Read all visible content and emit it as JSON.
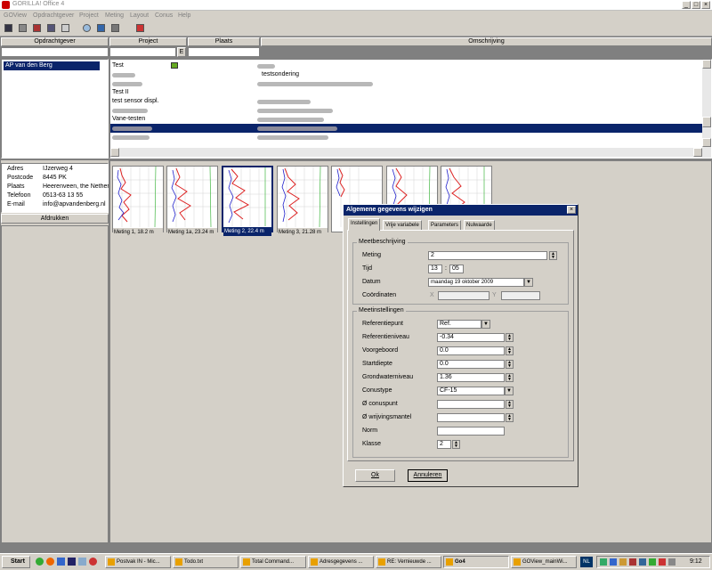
{
  "window": {
    "title": "GORILLA! Office 4",
    "min": "_",
    "max": "□",
    "close": "×"
  },
  "menu": [
    "GOView",
    "Opdrachtgever",
    "Project",
    "Meting",
    "Layout",
    "Conus",
    "Help"
  ],
  "columns": {
    "client": "Opdrachtgever",
    "project": "Project",
    "place": "Plaats",
    "description": "Omschrijving",
    "filter_btn": "E"
  },
  "clients": [
    "AP van den Berg"
  ],
  "projects": [
    {
      "name": "Test",
      "desc": ""
    },
    {
      "name": "",
      "desc": "testsondering"
    },
    {
      "name": "Test II",
      "desc": ""
    },
    {
      "name": "test sensor displ.",
      "desc": ""
    },
    {
      "name": "",
      "desc": ""
    },
    {
      "name": "",
      "desc": ""
    },
    {
      "name": "Vane-testen",
      "desc": ""
    },
    {
      "name": "",
      "desc": ""
    },
    {
      "name": "",
      "desc": ""
    }
  ],
  "address": {
    "rows": [
      {
        "label": "Adres",
        "value": "IJzerweg 4"
      },
      {
        "label": "Postcode",
        "value": "8445 PK"
      },
      {
        "label": "Plaats",
        "value": "Heerenveen, the Nether"
      },
      {
        "label": "Telefoon",
        "value": "0513-63 13 55"
      },
      {
        "label": "E-mail",
        "value": "info@apvandenberg.nl"
      }
    ],
    "print_button": "Afdrukken"
  },
  "measurements": [
    "Meting 1, 18.2 m",
    "Meting 1a, 23.24 m",
    "Meting 2, 22.4 m",
    "Meting 3, 21.28 m",
    "",
    "",
    ""
  ],
  "dialog": {
    "title": "Algemene gegevens wijzigen",
    "tabs": [
      "Instellingen",
      "Vrije variabele",
      "Parameters",
      "Nulwaarde"
    ],
    "group1": "Meetbeschrijving",
    "meting_label": "Meting",
    "meting_value": "2",
    "tijd_label": "Tijd",
    "tijd_h": "13",
    "tijd_sep": ":",
    "tijd_m": "05",
    "datum_label": "Datum",
    "datum_value": "maandag 19  oktober  2009",
    "coord_label": "Coördinaten",
    "x_label": "X",
    "y_label": "Y",
    "group2": "Meetinstellingen",
    "settings": [
      {
        "label": "Referentiepunt",
        "value": "Ref.",
        "kind": "dd"
      },
      {
        "label": "Referentieniveau",
        "value": "-0.34",
        "kind": "spin"
      },
      {
        "label": "Voorgeboord",
        "value": "0.0",
        "kind": "spin"
      },
      {
        "label": "Startdiepte",
        "value": "0.0",
        "kind": "spin"
      },
      {
        "label": "Grondwaterniveau",
        "value": "1.36",
        "kind": "spin"
      },
      {
        "label": "Conustype",
        "value": "CF-15",
        "kind": "dd"
      },
      {
        "label": "Ø conuspunt",
        "value": "",
        "kind": "spin"
      },
      {
        "label": "Ø wrijvingsmantel",
        "value": "",
        "kind": "spin"
      },
      {
        "label": "Norm",
        "value": "",
        "kind": "plain"
      },
      {
        "label": "Klasse",
        "value": "2",
        "kind": "smallspin"
      }
    ],
    "ok": "Ok",
    "cancel": "Annuleren"
  },
  "taskbar": {
    "start": "Start",
    "tasks": [
      "Postvak IN - Mic...",
      "Todo.txt",
      "Total Command...",
      "Adresgegevens ...",
      "RE: Vernieuwde ...",
      "Go4",
      "GOView_mainWi..."
    ],
    "lang": "NL",
    "clock": "9:12"
  }
}
